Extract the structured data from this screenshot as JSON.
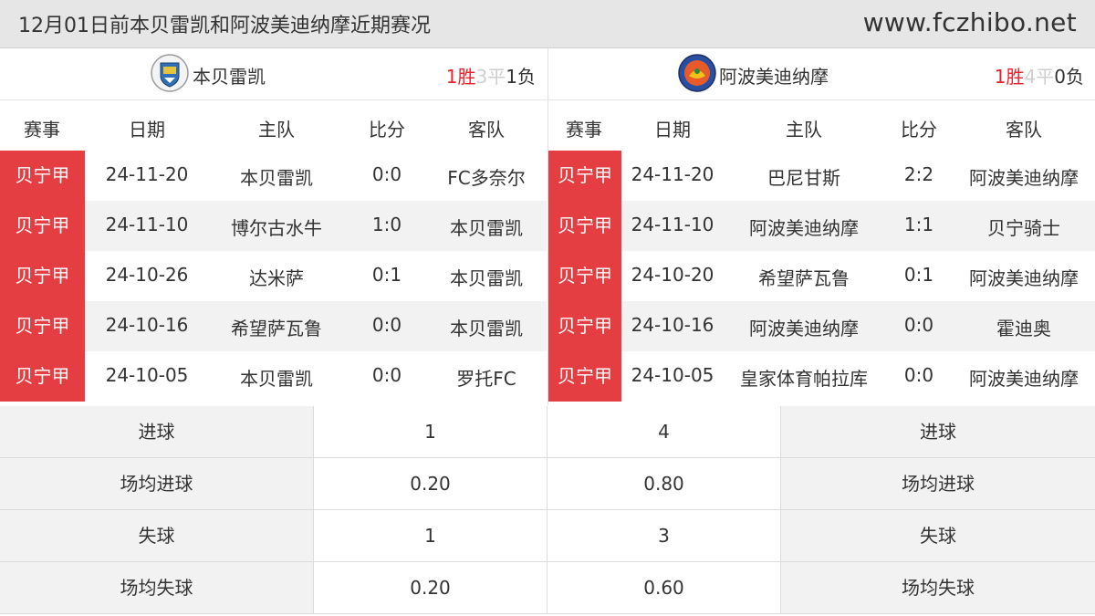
{
  "header": {
    "title": "12月01日前本贝雷凯和阿波美迪纳摩近期赛况",
    "site": "www.fczhibo.net"
  },
  "columns": {
    "league": "赛事",
    "date": "日期",
    "home": "主队",
    "score": "比分",
    "away": "客队"
  },
  "left": {
    "team_name": "本贝雷凯",
    "logo_icon": "benbereke-crest-icon",
    "record": {
      "win": "1胜",
      "draw": "3平",
      "loss": "1负"
    },
    "matches": [
      {
        "league": "贝宁甲",
        "date": "24-11-20",
        "home": "本贝雷凯",
        "score": "0:0",
        "away": "FC多奈尔"
      },
      {
        "league": "贝宁甲",
        "date": "24-11-10",
        "home": "博尔古水牛",
        "score": "1:0",
        "away": "本贝雷凯"
      },
      {
        "league": "贝宁甲",
        "date": "24-10-26",
        "home": "达米萨",
        "score": "0:1",
        "away": "本贝雷凯"
      },
      {
        "league": "贝宁甲",
        "date": "24-10-16",
        "home": "希望萨瓦鲁",
        "score": "0:0",
        "away": "本贝雷凯"
      },
      {
        "league": "贝宁甲",
        "date": "24-10-05",
        "home": "本贝雷凯",
        "score": "0:0",
        "away": "罗托FC"
      }
    ]
  },
  "right": {
    "team_name": "阿波美迪纳摩",
    "logo_icon": "abomey-dynamo-crest-icon",
    "record": {
      "win": "1胜",
      "draw": "4平",
      "loss": "0负"
    },
    "matches": [
      {
        "league": "贝宁甲",
        "date": "24-11-20",
        "home": "巴尼甘斯",
        "score": "2:2",
        "away": "阿波美迪纳摩"
      },
      {
        "league": "贝宁甲",
        "date": "24-11-10",
        "home": "阿波美迪纳摩",
        "score": "1:1",
        "away": "贝宁骑士"
      },
      {
        "league": "贝宁甲",
        "date": "24-10-20",
        "home": "希望萨瓦鲁",
        "score": "0:1",
        "away": "阿波美迪纳摩"
      },
      {
        "league": "贝宁甲",
        "date": "24-10-16",
        "home": "阿波美迪纳摩",
        "score": "0:0",
        "away": "霍迪奥"
      },
      {
        "league": "贝宁甲",
        "date": "24-10-05",
        "home": "皇家体育帕拉库",
        "score": "0:0",
        "away": "阿波美迪纳摩"
      }
    ]
  },
  "stats": [
    {
      "label": "进球",
      "left": "1",
      "right": "4"
    },
    {
      "label": "场均进球",
      "left": "0.20",
      "right": "0.80"
    },
    {
      "label": "失球",
      "left": "1",
      "right": "3"
    },
    {
      "label": "场均失球",
      "left": "0.20",
      "right": "0.60"
    }
  ],
  "colors": {
    "league_badge": "#e43d42",
    "win": "#e8212a",
    "draw": "#cfcfcf",
    "header_bg": "#e6e6e6",
    "alt_row": "#f2f2f2"
  }
}
